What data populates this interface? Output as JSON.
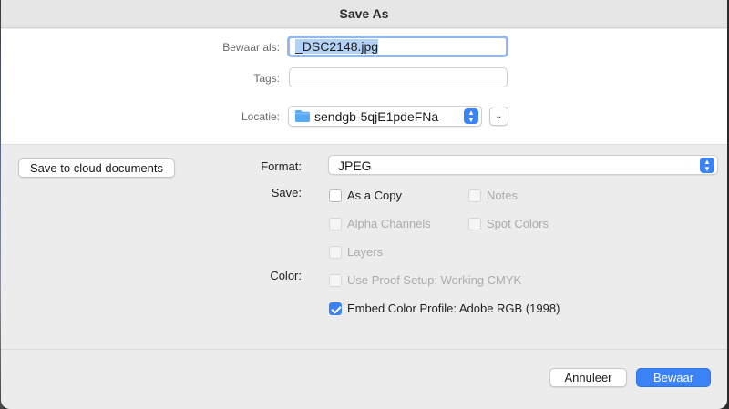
{
  "dialog": {
    "title": "Save As"
  },
  "save_as": {
    "label": "Bewaar als:",
    "value": "_DSC2148.jpg"
  },
  "tags": {
    "label": "Tags:",
    "value": ""
  },
  "location": {
    "label": "Locatie:",
    "value": "sendgb-5qjE1pdeFNa"
  },
  "cloud_button": "Save to cloud documents",
  "format": {
    "label": "Format:",
    "value": "JPEG"
  },
  "save_section": {
    "label": "Save:",
    "as_copy": "As a Copy",
    "notes": "Notes",
    "alpha_channels": "Alpha Channels",
    "spot_colors": "Spot Colors",
    "layers": "Layers"
  },
  "color_section": {
    "label": "Color:",
    "use_proof_setup": "Use Proof Setup:  Working CMYK",
    "embed_color_profile": "Embed Color Profile:  Adobe RGB (1998)"
  },
  "footer": {
    "cancel": "Annuleer",
    "save": "Bewaar"
  },
  "colors": {
    "accent": "#3b82f6",
    "dialog_bg": "#ececec"
  },
  "icons": {
    "folder": "folder-icon",
    "stepper": "up-down-chevron-icon",
    "expand": "chevron-down-icon"
  }
}
